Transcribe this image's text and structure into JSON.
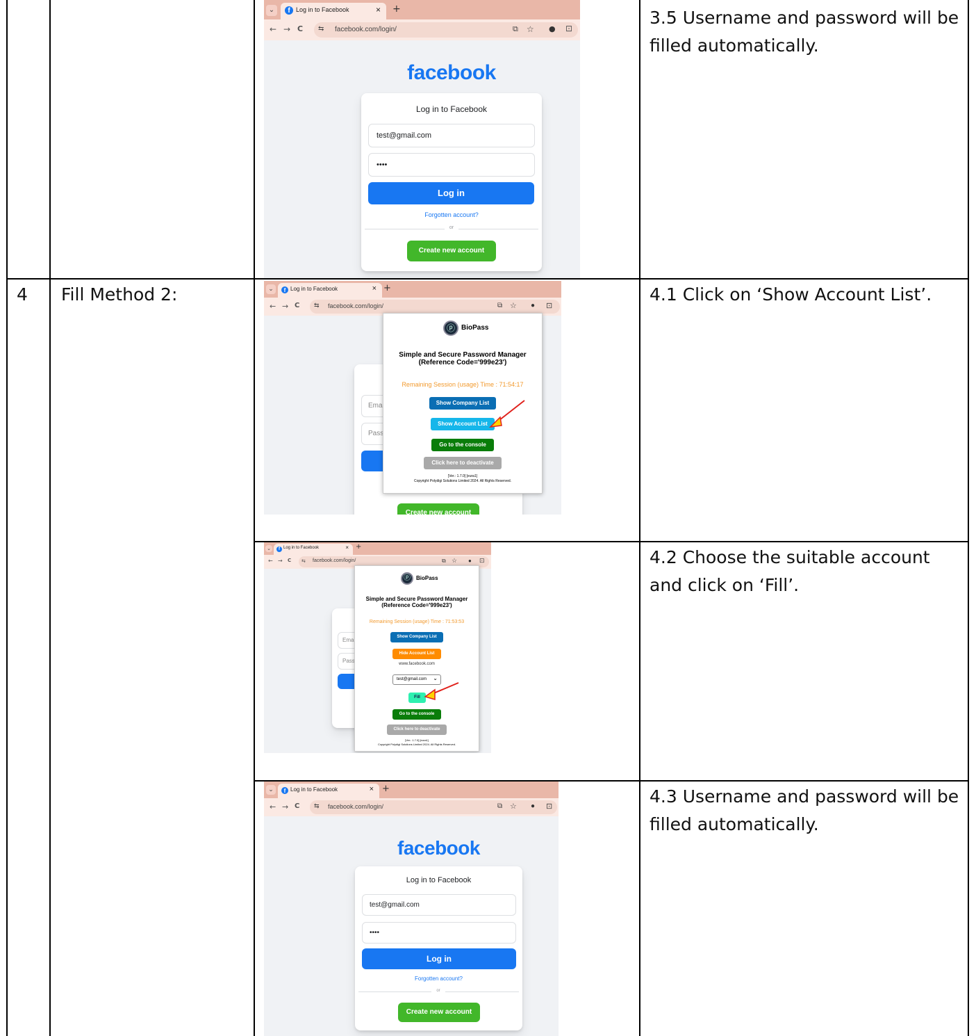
{
  "table": {
    "rows": [
      {
        "num": "",
        "method": "",
        "steps": [
          {
            "desc": "3.5 Username and password will be filled automatically."
          }
        ]
      },
      {
        "num": "4",
        "method": "Fill Method 2:",
        "steps": [
          {
            "desc": "4.1 Click on ‘Show Account List’."
          },
          {
            "desc": "4.2 Choose the suitable account and click on ‘Fill’."
          },
          {
            "desc": "4.3 Username and password will be filled automatically."
          }
        ]
      }
    ]
  },
  "browser": {
    "tab_title": "Log in to Facebook",
    "tab_close": "×",
    "new_tab": "+",
    "url": "facebook.com/login/",
    "back": "←",
    "forward": "→",
    "reload": "C",
    "menu": "⌄",
    "favicon": "f",
    "star": "☆",
    "cast": "⧉",
    "ext": "●",
    "puzzle": "⊡",
    "site_settings": "⇆"
  },
  "facebook": {
    "logo": "facebook",
    "card_title": "Log in to Facebook",
    "email_value": "test@gmail.com",
    "password_value": "••••",
    "login_label": "Log in",
    "forgot_label": "Forgotten account?",
    "or_label": "or",
    "create_label": "Create new account",
    "email_placeholder_partial": "Ema",
    "password_placeholder_partial": "Pass",
    "create_partial": "Create new account"
  },
  "biopass": {
    "name": "BioPass",
    "logo_glyph": "ⓟ",
    "title_line1": "Simple and Secure Password Manager",
    "title_line2": "(Reference Code='999e23')",
    "session_a": "Remaining Session (usage) Time : 71:54:17",
    "session_b": "Remaining Session (usage) Time : 71:53:53",
    "show_company": "Show Company List",
    "show_account": "Show Account List",
    "hide_account": "Hide Account List",
    "console": "Go to the console",
    "deactivate": "Click here to deactivate",
    "site": "www.facebook.com",
    "account_select": "test@gmail.com",
    "select_arrow": "⌄",
    "fill": "Fill",
    "version": "[Ver.: 1.7.0] [eura1]",
    "copyright": "Copyright Polydigi Solutions Limited 2024. All Rights Reserved.",
    "arrow_color": "#e0201b",
    "arrow_head_color": "#ffd400"
  },
  "colors": {
    "fb_blue": "#1877f2",
    "fb_green": "#42b72a",
    "tab_bar": "#e9b7a8",
    "company_btn": "#0a6eb4",
    "account_btn": "#15b6ea",
    "hide_btn": "#ff8c00",
    "console_btn": "#0a7d0a",
    "deactivate_btn": "#a9a9a9",
    "fill_btn": "#2ef0b0",
    "session_text": "#f29a2e"
  }
}
